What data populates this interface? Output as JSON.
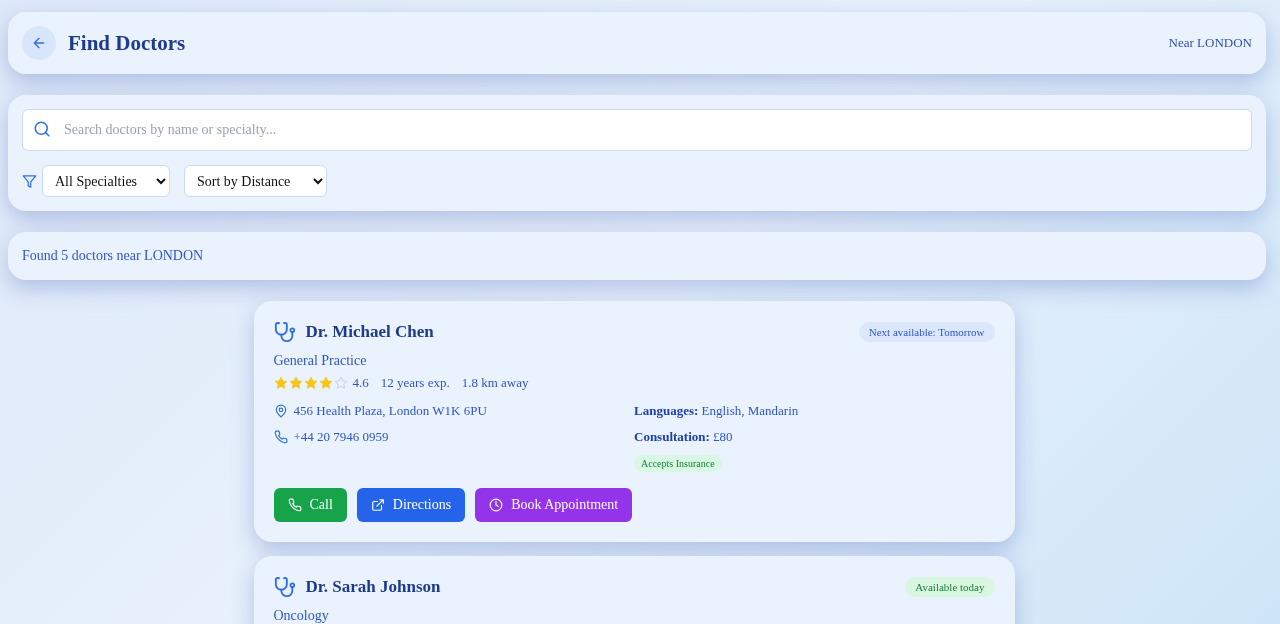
{
  "header": {
    "title": "Find Doctors",
    "location": "Near LONDON"
  },
  "search": {
    "placeholder": "Search doctors by name or specialty..."
  },
  "filters": [
    {
      "value": "All Specialties"
    },
    {
      "value": "Sort by Distance"
    }
  ],
  "results_summary": "Found 5 doctors near LONDON",
  "doctors": [
    {
      "name": "Dr. Michael Chen",
      "availability": {
        "text": "Next available: Tomorrow",
        "kind": "later"
      },
      "specialty": "General Practice",
      "stars": 4,
      "rating": "4.6",
      "experience": "12 years exp.",
      "distance": "1.8 km away",
      "address": "456 Health Plaza, London W1K 6PU",
      "phone": "+44 20 7946 0959",
      "languages": "**Languages:** English, Mandarin",
      "consultation": "**Consultation:** £80",
      "insurance": "Accepts Insurance",
      "buttons": [
        {
          "label": "Call",
          "kind": "call"
        },
        {
          "label": "Directions",
          "kind": "directions"
        },
        {
          "label": "Book Appointment",
          "kind": "book"
        }
      ]
    },
    {
      "name": "Dr. Sarah Johnson",
      "availability": {
        "text": "Available today",
        "kind": "today"
      },
      "specialty": "Oncology"
    }
  ]
}
